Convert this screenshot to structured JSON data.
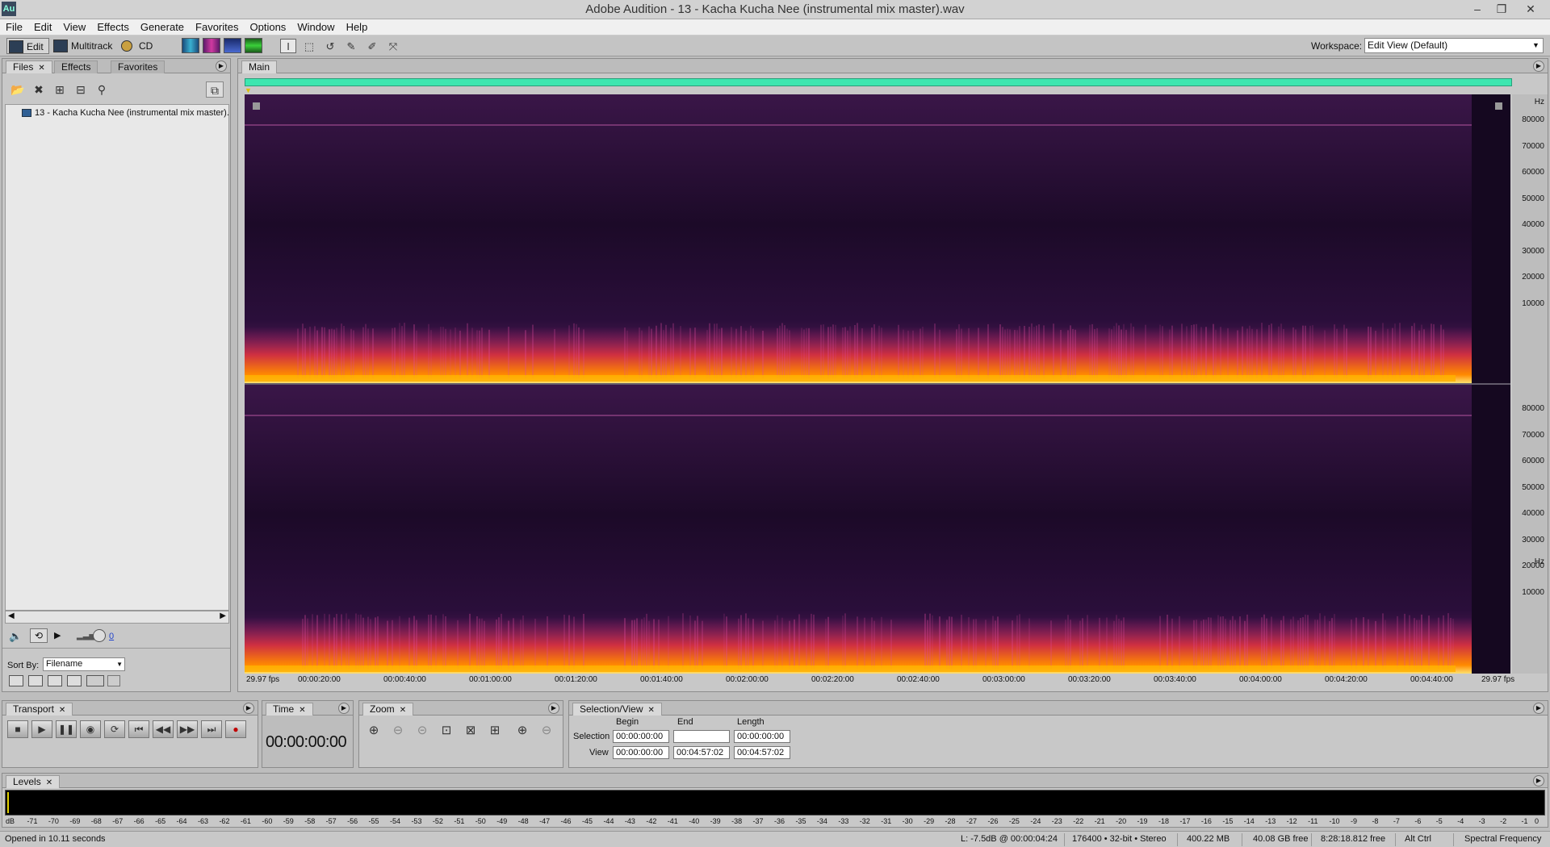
{
  "window": {
    "app_icon": "Au",
    "title": "Adobe Audition - 13 - Kacha Kucha Nee (instrumental mix master).wav",
    "controls": [
      "–",
      "❐",
      "✕"
    ]
  },
  "menu": [
    "File",
    "Edit",
    "View",
    "Effects",
    "Generate",
    "Favorites",
    "Options",
    "Window",
    "Help"
  ],
  "toolbar": {
    "edit_label": "Edit",
    "multitrack_label": "Multitrack",
    "cd_label": "CD",
    "workspace_label": "Workspace:",
    "workspace_value": "Edit View (Default)"
  },
  "files_panel": {
    "tabs": [
      "Files",
      "Effects",
      "Favorites"
    ],
    "file_name": "13 - Kacha Kucha Nee (instrumental mix master).wav",
    "sort_label": "Sort By:",
    "sort_value": "Filename",
    "volume_value": "0"
  },
  "main_panel": {
    "tab": "Main",
    "hz_unit": "Hz",
    "hz_ticks": [
      "80000",
      "70000",
      "60000",
      "50000",
      "40000",
      "30000",
      "20000",
      "10000"
    ],
    "fps_left": "29.97 fps",
    "fps_right": "29.97 fps",
    "time_ticks": [
      "00:00:20:00",
      "00:00:40:00",
      "00:01:00:00",
      "00:01:20:00",
      "00:01:40:00",
      "00:02:00:00",
      "00:02:20:00",
      "00:02:40:00",
      "00:03:00:00",
      "00:03:20:00",
      "00:03:40:00",
      "00:04:00:00",
      "00:04:20:00",
      "00:04:40:00"
    ]
  },
  "transport": {
    "title": "Transport"
  },
  "time_panel": {
    "title": "Time",
    "value": "00:00:00:00"
  },
  "zoom_panel": {
    "title": "Zoom"
  },
  "selection_panel": {
    "title": "Selection/View",
    "col_begin": "Begin",
    "col_end": "End",
    "col_length": "Length",
    "row_selection": "Selection",
    "row_view": "View",
    "sel_begin": "00:00:00:00",
    "sel_end": "",
    "sel_length": "00:00:00:00",
    "view_begin": "00:00:00:00",
    "view_end": "00:04:57:02",
    "view_length": "00:04:57:02"
  },
  "levels": {
    "title": "Levels",
    "db_ticks": [
      "dB",
      "-71",
      "-70",
      "-69",
      "-68",
      "-67",
      "-66",
      "-65",
      "-64",
      "-63",
      "-62",
      "-61",
      "-60",
      "-59",
      "-58",
      "-57",
      "-56",
      "-55",
      "-54",
      "-53",
      "-52",
      "-51",
      "-50",
      "-49",
      "-48",
      "-47",
      "-46",
      "-45",
      "-44",
      "-43",
      "-42",
      "-41",
      "-40",
      "-39",
      "-38",
      "-37",
      "-36",
      "-35",
      "-34",
      "-33",
      "-32",
      "-31",
      "-30",
      "-29",
      "-28",
      "-27",
      "-26",
      "-25",
      "-24",
      "-23",
      "-22",
      "-21",
      "-20",
      "-19",
      "-18",
      "-17",
      "-16",
      "-15",
      "-14",
      "-13",
      "-12",
      "-11",
      "-10",
      "-9",
      "-8",
      "-7",
      "-6",
      "-5",
      "-4",
      "-3",
      "-2",
      "-1",
      "0"
    ]
  },
  "status": {
    "opened": "Opened in 10.11 seconds",
    "cursor": "L: -7.5dB @ 00:00:04:24",
    "format": "176400 • 32-bit • Stereo",
    "size": "400.22 MB",
    "disk_free": "40.08 GB free",
    "time_free": "8:28:18.812 free",
    "keys": "Alt Ctrl",
    "view_mode": "Spectral Frequency"
  },
  "colors": {
    "overview": "#3de6b0",
    "spectro_bg": "#1a0a2a",
    "spectro_hot": "#ffb000"
  }
}
